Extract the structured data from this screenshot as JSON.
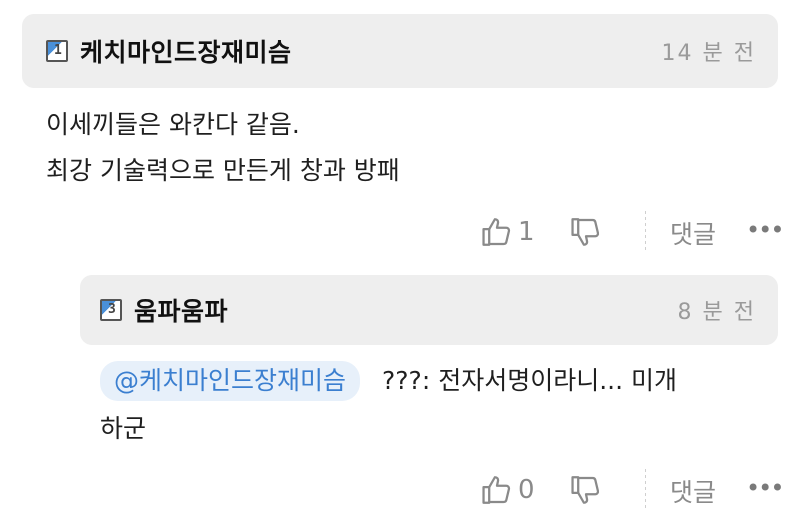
{
  "comments": [
    {
      "level": "1",
      "author": "케치마인드장재미슴",
      "time": "14 분 전",
      "lines": [
        "이세끼들은 와칸다 같음.",
        "최강 기술력으로 만든게 창과 방패"
      ],
      "likes": "1",
      "reply_label": "댓글",
      "more_label": "•••"
    },
    {
      "level": "3",
      "author": "움파움파",
      "time": "8 분 전",
      "mention": "@케치마인드장재미슴",
      "line1": "???: 전자서명이라니... 미개",
      "line2": "하군",
      "likes": "0",
      "reply_label": "댓글",
      "more_label": "•••"
    }
  ]
}
